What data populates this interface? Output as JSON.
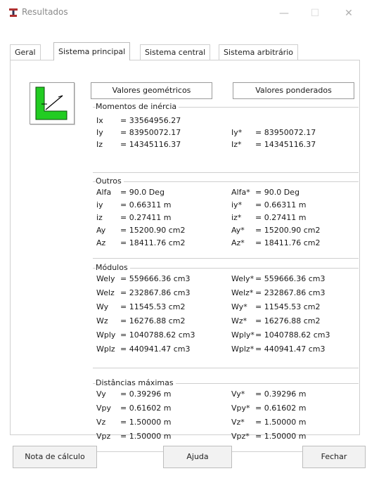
{
  "window": {
    "title": "Resultados",
    "minimize": "—",
    "maximize": "☐",
    "close": "✕"
  },
  "tabs": [
    "Geral",
    "Sistema principal",
    "Sistema central",
    "Sistema arbitrário"
  ],
  "headers": {
    "geometric": "Valores geométricos",
    "weighted": "Valores ponderados"
  },
  "inertia": {
    "title": "Momentos de inércia",
    "rows": [
      {
        "l": "Ix",
        "v": "= 33564956.27",
        "l2": "",
        "v2": ""
      },
      {
        "l": "Iy",
        "v": "= 83950072.17",
        "l2": "Iy*",
        "v2": "= 83950072.17"
      },
      {
        "l": "Iz",
        "v": "= 14345116.37",
        "l2": "Iz*",
        "v2": "= 14345116.37"
      }
    ]
  },
  "outros": {
    "title": "Outros",
    "rows": [
      {
        "l": "Alfa",
        "v": "= 90.0 Deg",
        "l2": "Alfa*",
        "v2": "= 90.0 Deg"
      },
      {
        "l": "iy",
        "v": "= 0.66311 m",
        "l2": "iy*",
        "v2": "= 0.66311 m"
      },
      {
        "l": "iz",
        "v": "= 0.27411 m",
        "l2": "iz*",
        "v2": "= 0.27411 m"
      },
      {
        "l": "Ay",
        "v": "= 15200.90 cm2",
        "l2": "Ay*",
        "v2": "= 15200.90 cm2"
      },
      {
        "l": "Az",
        "v": "= 18411.76 cm2",
        "l2": "Az*",
        "v2": "= 18411.76 cm2"
      }
    ]
  },
  "modulos": {
    "title": "Módulos",
    "rows": [
      {
        "l": "Wely",
        "v": "= 559666.36 cm3",
        "l2": "Wely*",
        "v2": "= 559666.36 cm3"
      },
      {
        "l": "Welz",
        "v": "= 232867.86 cm3",
        "l2": "Welz*",
        "v2": "= 232867.86 cm3"
      },
      {
        "l": "Wy",
        "v": "= 11545.53 cm2",
        "l2": "Wy*",
        "v2": "= 11545.53 cm2"
      },
      {
        "l": "Wz",
        "v": "= 16276.88 cm2",
        "l2": "Wz*",
        "v2": "= 16276.88 cm2"
      },
      {
        "l": "Wply",
        "v": "= 1040788.62 cm3",
        "l2": "Wply*",
        "v2": "= 1040788.62 cm3"
      },
      {
        "l": "Wplz",
        "v": "= 440941.47 cm3",
        "l2": "Wplz*",
        "v2": "= 440941.47 cm3"
      }
    ]
  },
  "distancias": {
    "title": "Distâncias máximas",
    "rows": [
      {
        "l": "Vy",
        "v": "= 0.39296 m",
        "l2": "Vy*",
        "v2": "= 0.39296 m"
      },
      {
        "l": "Vpy",
        "v": "= 0.61602 m",
        "l2": "Vpy*",
        "v2": "= 0.61602 m"
      },
      {
        "l": "Vz",
        "v": "= 1.50000 m",
        "l2": "Vz*",
        "v2": "= 1.50000 m"
      },
      {
        "l": "Vpz",
        "v": "= 1.50000 m",
        "l2": "Vpz*",
        "v2": "= 1.50000 m"
      }
    ]
  },
  "buttons": {
    "report": "Nota de cálculo",
    "help": "Ajuda",
    "close": "Fechar"
  },
  "icons": {
    "app": "beam-icon",
    "profile": "l-profile-icon"
  },
  "colors": {
    "profile_green": "#22cc22",
    "border": "#cfcfcf"
  }
}
